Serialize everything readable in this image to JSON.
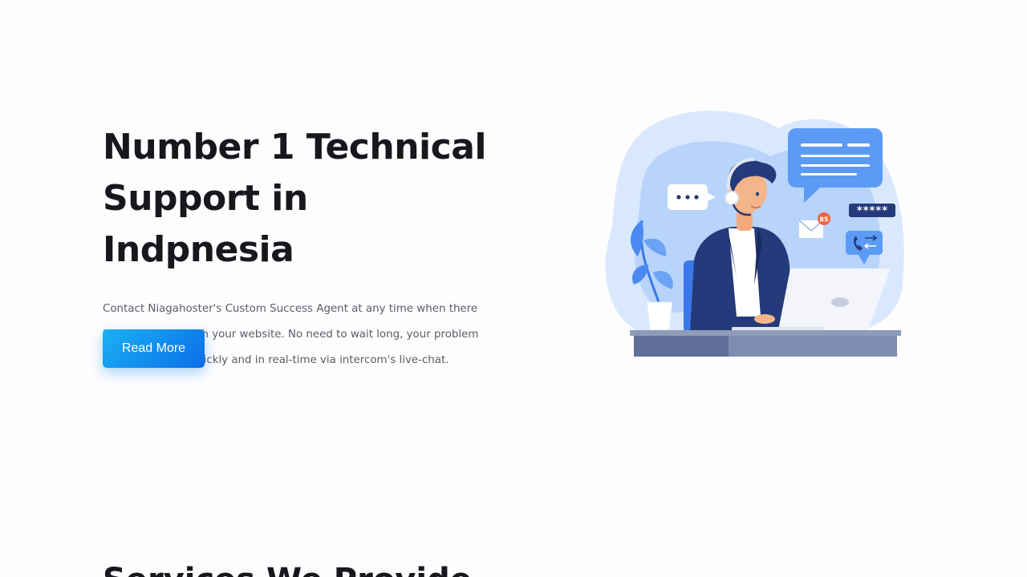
{
  "hero": {
    "title_line1": "Number 1 Technical",
    "title_line2": "Support in Indpnesia",
    "description": "Contact Niagahoster's Custom Success Agent at any time when there is a parobleem with your website. No need to wait long, your problem will be resloved quickly and in real-time via intercom's live-chat.",
    "read_more_label": "Read More"
  },
  "illustration": {
    "email_badge": "85",
    "password_mask": "*****"
  },
  "services": {
    "heading": "Services We Provide"
  },
  "colors": {
    "accent_start": "#1bb1f4",
    "accent_end": "#0a6ee8",
    "heading": "#16181d",
    "body_text": "#5a5d66",
    "illustration_navy": "#253a7a",
    "illustration_blue": "#5b9bf5"
  }
}
